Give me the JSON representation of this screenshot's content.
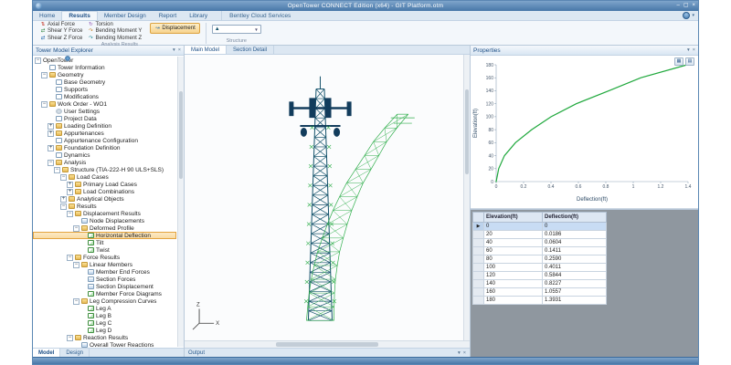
{
  "titlebar": {
    "title": "OpenTower CONNECT Edition (x64) - GIT Platform.otm",
    "buttons": {
      "minimize": "–",
      "maximize": "▢",
      "close": "×"
    }
  },
  "ribbon": {
    "tabs": [
      {
        "label": "Home",
        "active": false
      },
      {
        "label": "Results",
        "active": true
      },
      {
        "label": "Member Design",
        "active": false
      },
      {
        "label": "Report",
        "active": false
      },
      {
        "label": "Library",
        "active": false
      }
    ],
    "cloud_services_label": "Bentley Cloud Services",
    "groups": {
      "analysis": {
        "caption": "Analysis Results",
        "force_items": [
          {
            "label": "Axial Force",
            "glyph": "⇅",
            "color": "#c43b2f",
            "icon": "axial-force-icon"
          },
          {
            "label": "Shear Y Force",
            "glyph": "⇄",
            "color": "#2e8540",
            "icon": "shear-y-force-icon"
          },
          {
            "label": "Shear Z Force",
            "glyph": "⇄",
            "color": "#1a62a8",
            "icon": "shear-z-force-icon"
          }
        ],
        "moment_items": [
          {
            "label": "Torsion",
            "glyph": "↻",
            "color": "#8a4bb0",
            "icon": "torsion-icon"
          },
          {
            "label": "Bending Moment Y",
            "glyph": "↷",
            "color": "#c07a1a",
            "icon": "bending-moment-y-icon"
          },
          {
            "label": "Bending Moment Z",
            "glyph": "↷",
            "color": "#12808a",
            "icon": "bending-moment-z-icon"
          }
        ],
        "displacement": {
          "label": "Displacement",
          "glyph": "↝",
          "color": "#1a62a8",
          "active": true
        }
      },
      "structure": {
        "caption": "Structure",
        "value": ""
      }
    }
  },
  "explorer": {
    "title": "Tower Model Explorer",
    "bottom_tabs": [
      {
        "label": "Model",
        "active": true
      },
      {
        "label": "Design",
        "active": false
      }
    ],
    "items": [
      {
        "label": "OpenTower",
        "depth": 0,
        "expand": "open",
        "icon": "app"
      },
      {
        "label": "Tower Information",
        "depth": 1,
        "expand": null,
        "icon": "doc"
      },
      {
        "label": "Geometry",
        "depth": 1,
        "expand": "open",
        "icon": "folder"
      },
      {
        "label": "Base Geometry",
        "depth": 2,
        "expand": null,
        "icon": "doc"
      },
      {
        "label": "Supports",
        "depth": 2,
        "expand": null,
        "icon": "doc"
      },
      {
        "label": "Modifications",
        "depth": 2,
        "expand": null,
        "icon": "doc"
      },
      {
        "label": "Work Order - WO1",
        "depth": 1,
        "expand": "open",
        "icon": "folder"
      },
      {
        "label": "User Settings",
        "depth": 2,
        "expand": null,
        "icon": "gear"
      },
      {
        "label": "Project Data",
        "depth": 2,
        "expand": null,
        "icon": "doc"
      },
      {
        "label": "Loading Definition",
        "depth": 2,
        "expand": "closed",
        "icon": "folder"
      },
      {
        "label": "Appurtenances",
        "depth": 2,
        "expand": "closed",
        "icon": "folder"
      },
      {
        "label": "Appurtenance Configuration",
        "depth": 2,
        "expand": null,
        "icon": "doc"
      },
      {
        "label": "Foundation Definition",
        "depth": 2,
        "expand": "closed",
        "icon": "folder"
      },
      {
        "label": "Dynamics",
        "depth": 2,
        "expand": null,
        "icon": "doc"
      },
      {
        "label": "Analysis",
        "depth": 2,
        "expand": "open",
        "icon": "folder"
      },
      {
        "label": "Structure (TIA-222-H 90 ULS+SLS)",
        "depth": 3,
        "expand": "open",
        "icon": "folder"
      },
      {
        "label": "Load Cases",
        "depth": 4,
        "expand": "open",
        "icon": "folder"
      },
      {
        "label": "Primary Load Cases",
        "depth": 5,
        "expand": "closed",
        "icon": "folder"
      },
      {
        "label": "Load Combinations",
        "depth": 5,
        "expand": "closed",
        "icon": "folder"
      },
      {
        "label": "Analytical Objects",
        "depth": 4,
        "expand": "closed",
        "icon": "folder"
      },
      {
        "label": "Results",
        "depth": 4,
        "expand": "open",
        "icon": "folder"
      },
      {
        "label": "Displacement Results",
        "depth": 5,
        "expand": "open",
        "icon": "folder"
      },
      {
        "label": "Node Displacements",
        "depth": 6,
        "expand": null,
        "icon": "table"
      },
      {
        "label": "Deformed Profile",
        "depth": 6,
        "expand": "open",
        "icon": "folder"
      },
      {
        "label": "Horizontal Deflection",
        "depth": 7,
        "expand": null,
        "icon": "chart",
        "selected": true
      },
      {
        "label": "Tilt",
        "depth": 7,
        "expand": null,
        "icon": "chart"
      },
      {
        "label": "Twist",
        "depth": 7,
        "expand": null,
        "icon": "chart"
      },
      {
        "label": "Force Results",
        "depth": 5,
        "expand": "open",
        "icon": "folder"
      },
      {
        "label": "Linear Members",
        "depth": 6,
        "expand": "open",
        "icon": "folder"
      },
      {
        "label": "Member End Forces",
        "depth": 7,
        "expand": null,
        "icon": "table"
      },
      {
        "label": "Section Forces",
        "depth": 7,
        "expand": null,
        "icon": "table"
      },
      {
        "label": "Section Displacement",
        "depth": 7,
        "expand": null,
        "icon": "table"
      },
      {
        "label": "Member Force Diagrams",
        "depth": 7,
        "expand": null,
        "icon": "chart"
      },
      {
        "label": "Leg Compression Curves",
        "depth": 6,
        "expand": "open",
        "icon": "folder"
      },
      {
        "label": "Leg A",
        "depth": 7,
        "expand": null,
        "icon": "chart"
      },
      {
        "label": "Leg B",
        "depth": 7,
        "expand": null,
        "icon": "chart"
      },
      {
        "label": "Leg C",
        "depth": 7,
        "expand": null,
        "icon": "chart"
      },
      {
        "label": "Leg D",
        "depth": 7,
        "expand": null,
        "icon": "chart"
      },
      {
        "label": "Reaction Results",
        "depth": 5,
        "expand": "open",
        "icon": "folder"
      },
      {
        "label": "Overall Tower Reactions",
        "depth": 6,
        "expand": null,
        "icon": "table"
      }
    ]
  },
  "document": {
    "tabs": [
      {
        "label": "Main Model",
        "active": true
      },
      {
        "label": "Section Detail",
        "active": false
      }
    ],
    "axes": {
      "vertical": "Z",
      "horizontal": "X"
    }
  },
  "output_bar": {
    "label": "Output"
  },
  "properties_panel": {
    "title": "Properties"
  },
  "chart_data": {
    "type": "line",
    "title": "",
    "xlabel": "Deflection(ft)",
    "ylabel": "Elevation(ft)",
    "xlim": [
      0,
      1.4
    ],
    "ylim": [
      0,
      180
    ],
    "xticks": [
      0,
      0.2,
      0.4,
      0.6,
      0.8,
      1,
      1.2,
      1.4
    ],
    "yticks": [
      0,
      20,
      40,
      60,
      80,
      100,
      120,
      140,
      160,
      180
    ],
    "grid": false,
    "legend_position": "none",
    "series": [
      {
        "name": "Horizontal Deflection",
        "color": "#1fa83c",
        "x": [
          0,
          0.0186,
          0.0604,
          0.1411,
          0.259,
          0.4011,
          0.5844,
          0.8227,
          1.0557,
          1.3931
        ],
        "y": [
          0,
          20,
          40,
          60,
          80,
          100,
          120,
          140,
          160,
          180
        ]
      }
    ]
  },
  "results_table": {
    "columns": [
      "Elevation(ft)",
      "Deflection(ft)"
    ],
    "selected_row": 0,
    "selected_marker": "▶",
    "rows": [
      [
        "0",
        "0"
      ],
      [
        "20",
        "0.0186"
      ],
      [
        "40",
        "0.0604"
      ],
      [
        "60",
        "0.1411"
      ],
      [
        "80",
        "0.2590"
      ],
      [
        "100",
        "0.4011"
      ],
      [
        "120",
        "0.5844"
      ],
      [
        "140",
        "0.8227"
      ],
      [
        "160",
        "1.0557"
      ],
      [
        "180",
        "1.3931"
      ]
    ]
  },
  "colors": {
    "titlebar": "#4877a8",
    "selection_orange": "#e3a33f",
    "curve_green": "#1fa83c",
    "tower_model": "#14526b",
    "tower_deformed": "#2fae4b"
  }
}
